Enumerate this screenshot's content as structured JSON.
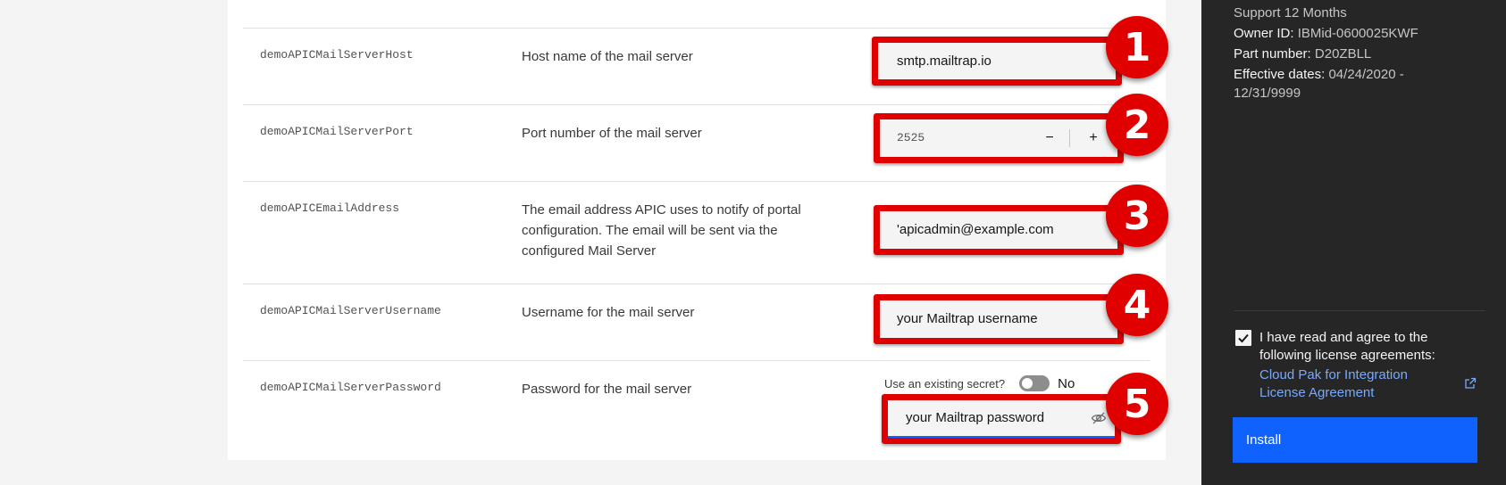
{
  "params": [
    {
      "key": "demoAPICMailServerHost",
      "description": "Host name of the mail server",
      "value": "smtp.mailtrap.io",
      "badge": "1"
    },
    {
      "key": "demoAPICMailServerPort",
      "description": "Port number of the mail server",
      "value": "2525",
      "badge": "2",
      "decrement": "−",
      "increment": "+"
    },
    {
      "key": "demoAPICEmailAddress",
      "description": "The email address APIC uses to notify of portal configuration. The email will be sent via the configured Mail Server",
      "value": "'apicadmin@example.com",
      "badge": "3"
    },
    {
      "key": "demoAPICMailServerUsername",
      "description": "Username for the mail server",
      "value": "your Mailtrap username",
      "badge": "4"
    },
    {
      "key": "demoAPICMailServerPassword",
      "description": "Password for the mail server",
      "value": "your Mailtrap password",
      "badge": "5",
      "secret_label": "Use an existing secret?",
      "secret_state": "No"
    }
  ],
  "side": {
    "line_top": "Support 12 Months",
    "owner_label": "Owner ID:",
    "owner_value": "IBMid-0600025KWF",
    "part_label": "Part number:",
    "part_value": "D20ZBLL",
    "dates_label": "Effective dates:",
    "dates_value": "04/24/2020 -",
    "dates_value_2": "12/31/9999",
    "agree_text": "I have read and agree to the following license agreements:",
    "license_link": "Cloud Pak for Integration License Agreement",
    "install_label": "Install"
  },
  "colors": {
    "callout": "#e00000",
    "install": "#0f62fe",
    "link": "#78a9ff"
  }
}
